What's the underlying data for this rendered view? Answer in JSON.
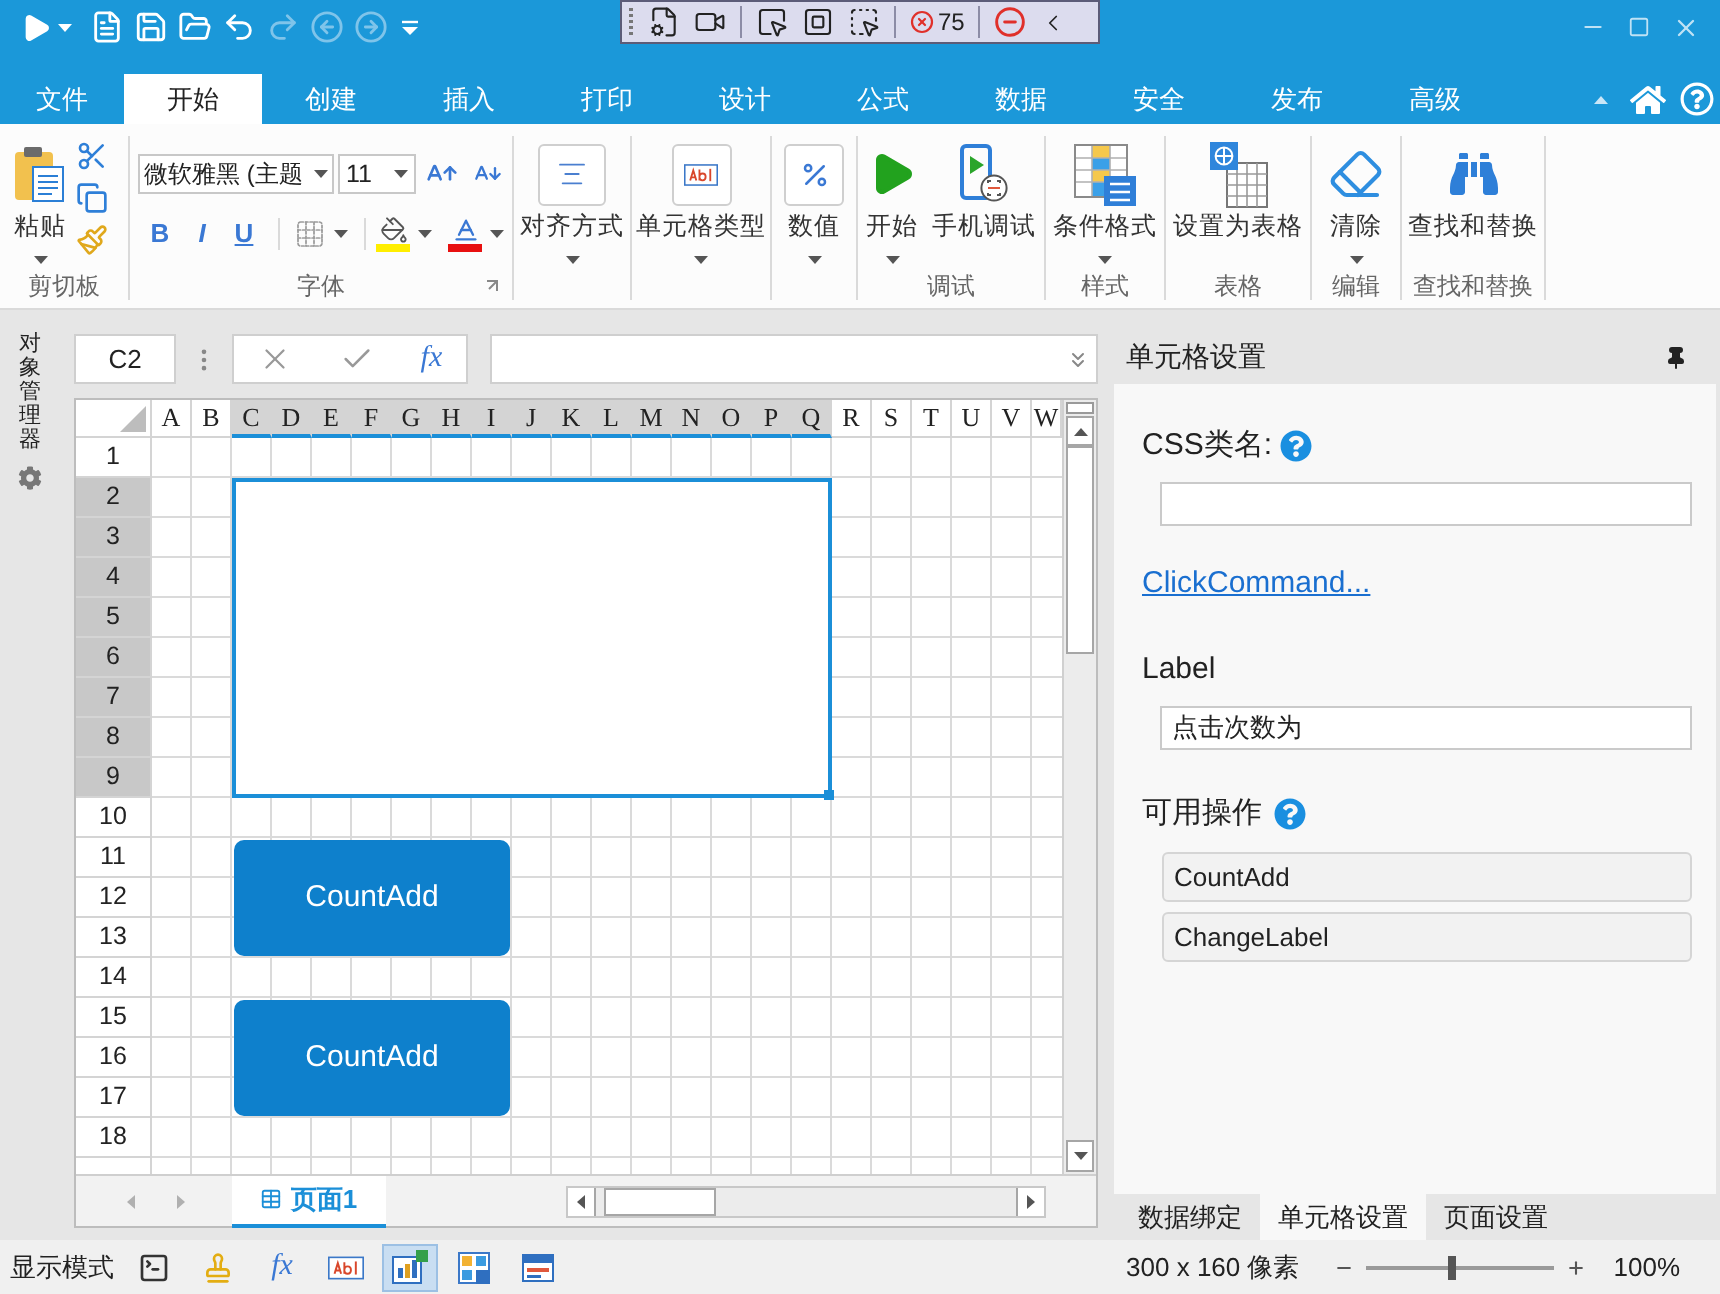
{
  "title_bar": {
    "quick_access": [
      {
        "kind": "run",
        "disabled": false
      },
      {
        "kind": "new",
        "disabled": false
      },
      {
        "kind": "save",
        "disabled": false
      },
      {
        "kind": "open",
        "disabled": false
      },
      {
        "kind": "undo",
        "disabled": false
      },
      {
        "kind": "redo",
        "disabled": true
      },
      {
        "kind": "back",
        "disabled": true
      },
      {
        "kind": "forward",
        "disabled": true
      }
    ],
    "debug_toolbar": {
      "error_count": "75"
    }
  },
  "menu_tabs": [
    {
      "label": "文件",
      "selected": false
    },
    {
      "label": "开始",
      "selected": true
    },
    {
      "label": "创建",
      "selected": false
    },
    {
      "label": "插入",
      "selected": false
    },
    {
      "label": "打印",
      "selected": false
    },
    {
      "label": "设计",
      "selected": false
    },
    {
      "label": "公式",
      "selected": false
    },
    {
      "label": "数据",
      "selected": false
    },
    {
      "label": "安全",
      "selected": false
    },
    {
      "label": "发布",
      "selected": false
    },
    {
      "label": "高级",
      "selected": false
    }
  ],
  "ribbon": {
    "clipboard": {
      "paste": "粘贴",
      "group_label": "剪切板"
    },
    "font": {
      "font_name": "微软雅黑 (主题",
      "font_size": "11",
      "bold": "B",
      "italic": "I",
      "underline": "U",
      "group_label": "字体"
    },
    "format_buttons": [
      {
        "kind": "align",
        "label": "对齐方式"
      },
      {
        "kind": "cell_type",
        "label": "单元格类型"
      },
      {
        "kind": "number",
        "label": "数值"
      }
    ],
    "groups": [
      {
        "label": "调试",
        "buttons": [
          {
            "kind": "start",
            "label": "开始",
            "dropdown": true
          },
          {
            "kind": "mobile",
            "label": "手机调试",
            "dropdown": false
          }
        ]
      },
      {
        "label": "样式",
        "buttons": [
          {
            "kind": "conditional",
            "label": "条件格式",
            "dropdown": true
          }
        ]
      },
      {
        "label": "表格",
        "buttons": [
          {
            "kind": "table",
            "label": "设置为表格",
            "dropdown": false
          }
        ]
      },
      {
        "label": "编辑",
        "buttons": [
          {
            "kind": "clear",
            "label": "清除",
            "dropdown": true
          }
        ]
      },
      {
        "label": "查找和替换",
        "buttons": [
          {
            "kind": "find",
            "label": "查找和替换",
            "dropdown": false
          }
        ]
      }
    ]
  },
  "object_manager": {
    "label": "对象管理器"
  },
  "formula_bar": {
    "name_box": "C2",
    "function_label": "fx"
  },
  "sheet": {
    "columns": [
      {
        "label": "A",
        "selected": false
      },
      {
        "label": "B",
        "selected": false
      },
      {
        "label": "C",
        "selected": true
      },
      {
        "label": "D",
        "selected": true
      },
      {
        "label": "E",
        "selected": true
      },
      {
        "label": "F",
        "selected": true
      },
      {
        "label": "G",
        "selected": true
      },
      {
        "label": "H",
        "selected": true
      },
      {
        "label": "I",
        "selected": true
      },
      {
        "label": "J",
        "selected": true
      },
      {
        "label": "K",
        "selected": true
      },
      {
        "label": "L",
        "selected": true
      },
      {
        "label": "M",
        "selected": true
      },
      {
        "label": "N",
        "selected": true
      },
      {
        "label": "O",
        "selected": true
      },
      {
        "label": "P",
        "selected": true
      },
      {
        "label": "Q",
        "selected": true
      },
      {
        "label": "R",
        "selected": false
      },
      {
        "label": "S",
        "selected": false
      },
      {
        "label": "T",
        "selected": false
      },
      {
        "label": "U",
        "selected": false
      },
      {
        "label": "V",
        "selected": false
      },
      {
        "label": "W",
        "selected": false
      }
    ],
    "rows": [
      {
        "label": "1",
        "selected": false
      },
      {
        "label": "2",
        "selected": true
      },
      {
        "label": "3",
        "selected": true
      },
      {
        "label": "4",
        "selected": true
      },
      {
        "label": "5",
        "selected": true
      },
      {
        "label": "6",
        "selected": true
      },
      {
        "label": "7",
        "selected": true
      },
      {
        "label": "8",
        "selected": true
      },
      {
        "label": "9",
        "selected": true
      },
      {
        "label": "10",
        "selected": false
      },
      {
        "label": "11",
        "selected": false
      },
      {
        "label": "12",
        "selected": false
      },
      {
        "label": "13",
        "selected": false
      },
      {
        "label": "14",
        "selected": false
      },
      {
        "label": "15",
        "selected": false
      },
      {
        "label": "16",
        "selected": false
      },
      {
        "label": "17",
        "selected": false
      },
      {
        "label": "18",
        "selected": false
      }
    ],
    "cell_buttons": [
      "CountAdd",
      "CountAdd"
    ],
    "page_tabs": [
      {
        "label": "页面1",
        "selected": true
      }
    ]
  },
  "cell_settings": {
    "title": "单元格设置",
    "css_class_label": "CSS类名:",
    "click_command_link": "ClickCommand...",
    "label_field": {
      "label": "Label",
      "value": "点击次数为"
    },
    "actions_label": "可用操作",
    "actions": [
      "CountAdd",
      "ChangeLabel"
    ],
    "tabs": [
      {
        "label": "数据绑定",
        "selected": false
      },
      {
        "label": "单元格设置",
        "selected": true
      },
      {
        "label": "页面设置",
        "selected": false
      }
    ]
  },
  "status_bar": {
    "mode_label": "显示模式",
    "modes": [
      {
        "kind": "console",
        "selected": false
      },
      {
        "kind": "marker",
        "selected": false
      },
      {
        "kind": "formula",
        "label": "fx",
        "selected": false
      },
      {
        "kind": "cell_type",
        "selected": false
      },
      {
        "kind": "report",
        "selected": true
      },
      {
        "kind": "layout",
        "selected": false
      },
      {
        "kind": "form",
        "selected": false
      }
    ],
    "size": "300 x 160 像素",
    "zoom": {
      "level": 0.46,
      "reading": "100%"
    }
  }
}
